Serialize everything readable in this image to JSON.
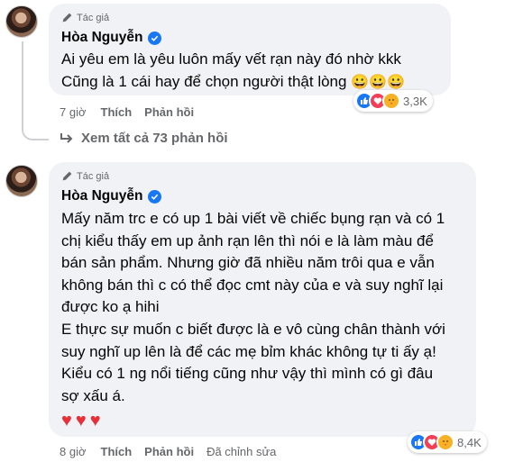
{
  "comments": [
    {
      "author_badge": "Tác giả",
      "author_name": "Hòa Nguyễn",
      "text_lines": [
        "Ai yêu em là yêu luôn mấy vết rạn này đó nhờ kkk",
        "Cũng là 1 cái hay để chọn người thật lòng"
      ],
      "emojis": "😀😀😀",
      "time": "7 giờ",
      "like_label": "Thích",
      "reply_label": "Phản hồi",
      "reaction_icons": [
        "like-icon",
        "love-icon",
        "care-icon"
      ],
      "reaction_count": "3,3K"
    },
    {
      "author_badge": "Tác giả",
      "author_name": "Hòa Nguyễn",
      "text_lines": [
        "Mấy năm trc e có up 1 bài viết về chiếc bụng rạn và có 1",
        "chị kiểu thấy em up ảnh rạn lên thì nói e là làm màu để",
        "bán sản phẩm. Nhưng giờ đã nhiều năm trôi qua e vẫn",
        "không bán thì c có thể đọc cmt này của e và suy nghĩ lại",
        "được ko ạ hihi",
        "E thực sự muốn c biết được là e vô cùng chân thành với",
        "suy nghĩ up lên là để các mẹ bỉm khác không tự ti ấy ạ!",
        "Kiểu có 1 ng nổi tiếng cũng như vậy thì mình có gì đâu",
        "sợ xấu á."
      ],
      "hearts": "♥♥♥",
      "time": "8 giờ",
      "like_label": "Thích",
      "reply_label": "Phản hồi",
      "edited_label": "Đã chỉnh sửa",
      "reaction_icons": [
        "like-icon",
        "love-icon",
        "care-icon"
      ],
      "reaction_count": "8,4K"
    }
  ],
  "see_all_replies": "Xem tất cả 73 phản hồi"
}
